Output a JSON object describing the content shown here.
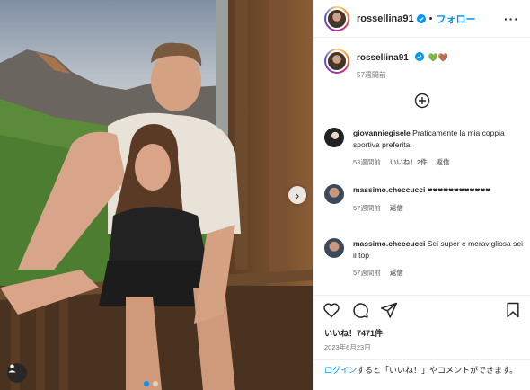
{
  "post": {
    "username": "rossellina91",
    "follow_label": "フォロー",
    "more_icon": "more-horizontal-icon",
    "caption_emojis": "💚🤎",
    "caption_time": "57週間前"
  },
  "comments": [
    {
      "user": "giovanniegisele",
      "text": "Praticamente la mia coppia sportiva preferita.",
      "time": "53週間前",
      "likes": "いいね！2件",
      "reply": "返信"
    },
    {
      "user": "massimo.checcucci",
      "text": "❤❤❤❤❤❤❤❤❤❤❤❤",
      "time": "57週間前",
      "reply": "返信"
    },
    {
      "user": "massimo.checcucci",
      "text": "Sei super e meravigliosa sei il top",
      "time": "57週間前",
      "reply": "返信"
    }
  ],
  "actions": {
    "like_icon": "heart-icon",
    "comment_icon": "comment-icon",
    "share_icon": "send-icon",
    "save_icon": "bookmark-icon"
  },
  "likes_count": "いいね！7471件",
  "post_date": "2023年6月23日",
  "login_prompt": {
    "link": "ログイン",
    "text": "すると「いいね！」やコメントができます。"
  },
  "colors": {
    "accent": "#0095f6",
    "secondary_text": "#737373",
    "border": "#efefef"
  }
}
